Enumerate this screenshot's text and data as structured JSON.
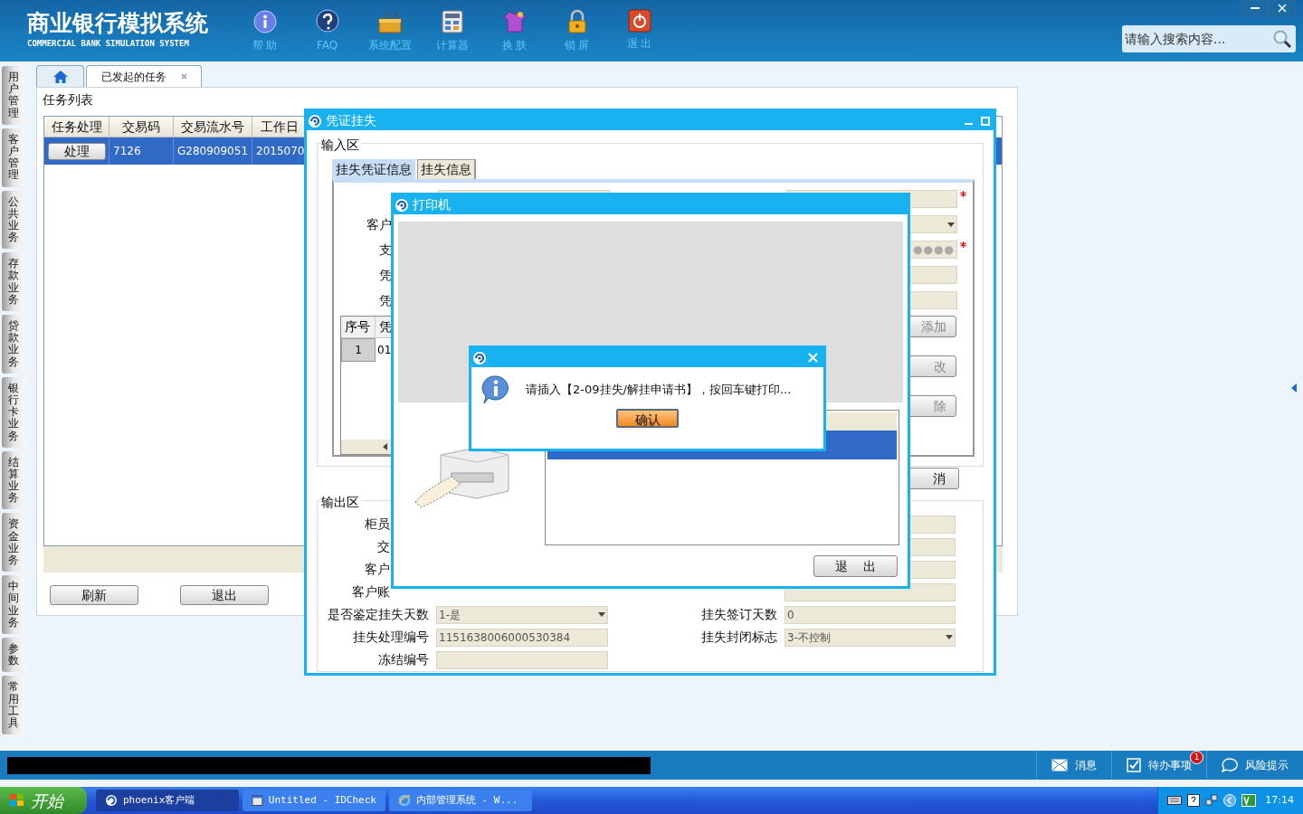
{
  "app": {
    "title": "商业银行模拟系统",
    "subtitle": "COMMERCIAL BANK SIMULATION SYSTEM"
  },
  "toolbar": [
    {
      "kind": "info",
      "label": "帮 助"
    },
    {
      "kind": "faq",
      "label": "FAQ"
    },
    {
      "kind": "config",
      "label": "系统配置"
    },
    {
      "kind": "calculator",
      "label": "计算器"
    },
    {
      "kind": "skin",
      "label": "换 肤"
    },
    {
      "kind": "lock",
      "label": "锁 屏"
    },
    {
      "kind": "exit",
      "label": "退 出"
    }
  ],
  "search": {
    "placeholder": "请输入搜索内容..."
  },
  "sidebar": {
    "items": [
      "用户管理",
      "客户管理",
      "公共业务",
      "存款业务",
      "贷款业务",
      "银行卡业务",
      "结算业务",
      "资金业务",
      "中间业务",
      "参数",
      "常用工具"
    ]
  },
  "tabs": [
    {
      "kind": "home",
      "selected": false
    },
    {
      "kind": "page",
      "label": "已发起的任务",
      "selected": true
    }
  ],
  "task_list": {
    "title": "任务列表",
    "columns": [
      "任务处理",
      "交易码",
      "交易流水号",
      "工作日"
    ],
    "rows": [
      {
        "selected": true,
        "cells": [
          "处理",
          "7126",
          "G280909051",
          "2015070"
        ]
      }
    ],
    "buttons": [
      "刷新",
      "退出"
    ]
  },
  "voucher_window": {
    "title": "凭证挂失",
    "input_area": {
      "title": "输入区",
      "tabs": [
        {
          "label": "挂失凭证信息",
          "selected": true
        },
        {
          "label": "挂失信息",
          "selected": false
        }
      ],
      "rows": [
        {
          "right": {
            "required": true
          }
        },
        {
          "left": {
            "label": "客户",
            "cut": true
          },
          "right": {
            "kind": "select"
          }
        },
        {
          "left": {
            "label": "支",
            "cut": true
          },
          "right": {
            "kind": "password",
            "value": "●●●●",
            "required": true
          }
        },
        {
          "left": {
            "label": "凭",
            "cut": true
          },
          "right": {
            "kind": "text"
          }
        },
        {
          "left": {
            "label": "凭",
            "cut": true
          },
          "right": {
            "kind": "text"
          }
        }
      ],
      "table": {
        "columns": [
          "序号",
          "凭"
        ],
        "rows": [
          [
            "1",
            "01"
          ]
        ]
      },
      "side_buttons": [
        "添加",
        "改",
        "除"
      ],
      "cancel": "消"
    },
    "output_area": {
      "title": "输出区",
      "rows": [
        {
          "left": {
            "label": "柜员",
            "cut": true
          },
          "right": {
            "kind": "text"
          }
        },
        {
          "left": {
            "label": "交",
            "cut": true
          },
          "right": {
            "kind": "text"
          }
        },
        {
          "left": {
            "label": "客户",
            "cut": true
          },
          "right": {
            "kind": "text"
          }
        },
        {
          "left": {
            "label": "客户账",
            "cut": true
          },
          "right": {
            "kind": "text"
          }
        },
        {
          "left": {
            "label": "是否鉴定挂失天数",
            "kind": "select",
            "value": "1-是"
          },
          "right": {
            "label": "挂失签订天数",
            "value": "0"
          }
        },
        {
          "left": {
            "label": "挂失处理编号",
            "value": "1151638006000530384"
          },
          "right": {
            "label": "挂失封闭标志",
            "kind": "select",
            "value": "3-不控制"
          }
        },
        {
          "left": {
            "label": "冻结编号"
          }
        }
      ]
    }
  },
  "printer_window": {
    "title": "打印机",
    "list_rows": [
      {
        "selected": true
      }
    ],
    "exit": "退    出"
  },
  "dialog": {
    "message": "请插入【2-09挂失/解挂申请书】，按回车键打印...",
    "confirm": "确认"
  },
  "status_bar": {
    "items": [
      {
        "kind": "message",
        "label": "消息"
      },
      {
        "kind": "todo",
        "label": "待办事项",
        "badge": "1"
      },
      {
        "kind": "risk",
        "label": "风险提示"
      }
    ]
  },
  "taskbar": {
    "start": "开始",
    "tasks": [
      {
        "kind": "app",
        "label": "phoenix客户端",
        "selected": true
      },
      {
        "kind": "window",
        "label": "Untitled - IDCheck",
        "selected": false
      },
      {
        "kind": "browser",
        "label": "内部管理系统 - W...",
        "selected": false
      }
    ],
    "clock": "17:14"
  }
}
